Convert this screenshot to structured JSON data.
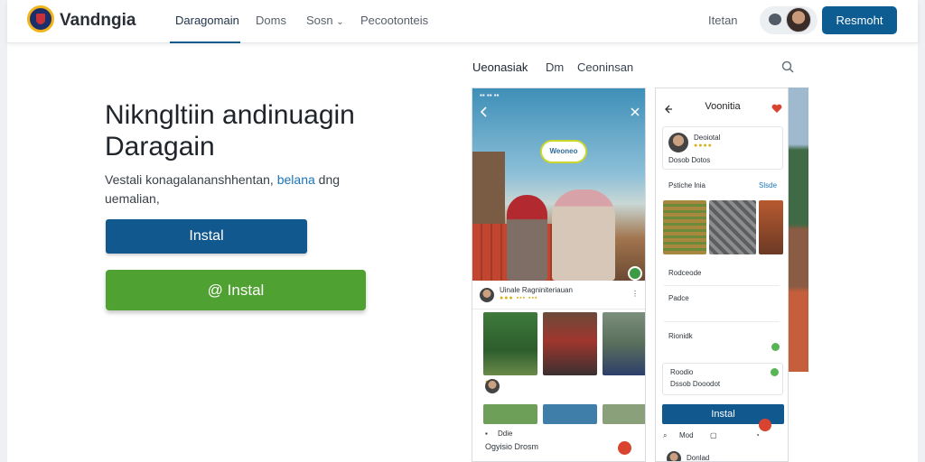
{
  "header": {
    "brand": "Vandngia",
    "nav": [
      "Daragomain",
      "Doms",
      "Sosn",
      "Pecootonteis"
    ],
    "nav_chevron": "⌄",
    "right_link": "Itetan",
    "cta_label": "Resmoht",
    "icons": [
      "logo-emblem",
      "chat-icon",
      "user-avatar"
    ]
  },
  "hero": {
    "headline_line1": "Nikngltiin andinuagin",
    "headline_line2": "Daragain",
    "subtext_pre": "Vestali konagalananshhentan,",
    "subtext_link": "belana",
    "subtext_post": "dng",
    "subtext_line2": "uemalian,",
    "btn_primary": "Instal",
    "btn_secondary": "Instal",
    "btn_secondary_icon": "@"
  },
  "showcase": {
    "tabs": [
      "Ueonasiak",
      "Dm",
      "Ceoninsan"
    ],
    "phone1": {
      "status": "▪▪ ▪▪ ▪▪",
      "badge": "Weoneo",
      "post_title": "Uinale Ragniniteriauan",
      "post_meta": "●●● ▪▪▪ ▪▪▪",
      "caption": "Ogyisio Drosm",
      "bottom_label": "Ddie"
    },
    "phone2": {
      "title": "Voonitia",
      "profile_name": "Deoiotal",
      "profile_sub": "Dosob Dotos",
      "section_left": "Pstiche lnia",
      "section_right": "Slsde",
      "list": [
        "Rodceode",
        "Padce",
        "Rionidk",
        "Roodio",
        "Dssob Dooodot"
      ],
      "install_label": "Instal",
      "bottom_label": "Mod",
      "footer_name": "Donlad"
    },
    "colors": {
      "primary": "#11588f",
      "success": "#4fa131",
      "accent_red": "#d8442f"
    }
  }
}
